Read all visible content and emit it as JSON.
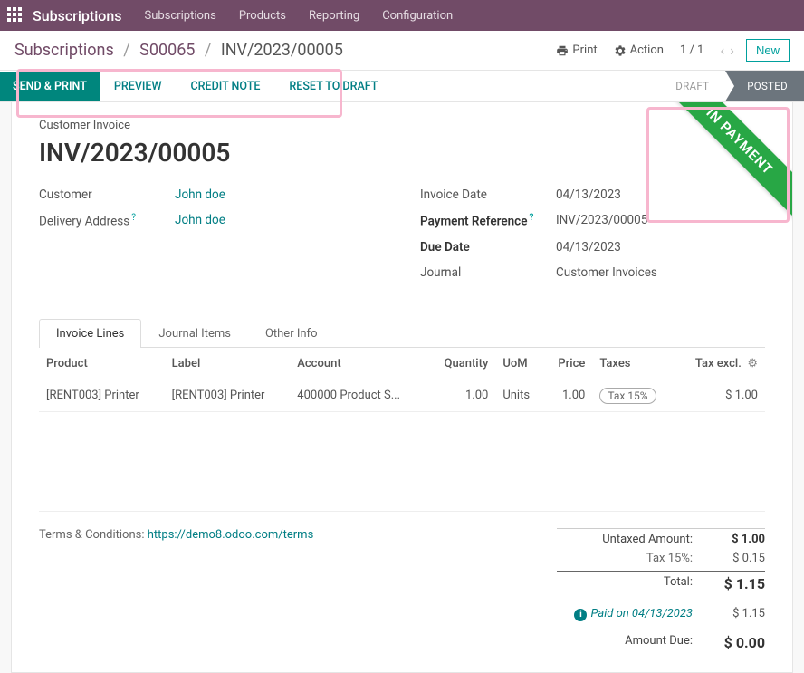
{
  "topnav": {
    "brand": "Subscriptions",
    "links": [
      "Subscriptions",
      "Products",
      "Reporting",
      "Configuration"
    ]
  },
  "crumb": {
    "root": "Subscriptions",
    "mid": "S00065",
    "current": "INV/2023/00005",
    "print": "Print",
    "action": "Action",
    "pager": "1 / 1",
    "new": "New"
  },
  "actions": {
    "send_print": "SEND & PRINT",
    "preview": "PREVIEW",
    "credit_note": "CREDIT NOTE",
    "reset_draft": "RESET TO DRAFT"
  },
  "status": {
    "draft": "DRAFT",
    "posted": "POSTED",
    "ribbon": "IN PAYMENT"
  },
  "doc": {
    "label": "Customer Invoice",
    "title": "INV/2023/00005"
  },
  "left": {
    "customer_l": "Customer",
    "customer_v": "John doe",
    "delivery_l": "Delivery Address",
    "delivery_v": "John doe"
  },
  "right": {
    "invdate_l": "Invoice Date",
    "invdate_v": "04/13/2023",
    "payref_l": "Payment Reference",
    "payref_v": "INV/2023/00005",
    "due_l": "Due Date",
    "due_v": "04/13/2023",
    "journal_l": "Journal",
    "journal_v": "Customer Invoices"
  },
  "tabs": {
    "lines": "Invoice Lines",
    "journal": "Journal Items",
    "other": "Other Info"
  },
  "th": {
    "product": "Product",
    "label": "Label",
    "account": "Account",
    "qty": "Quantity",
    "uom": "UoM",
    "price": "Price",
    "taxes": "Taxes",
    "taxexcl": "Tax excl."
  },
  "row": {
    "product": "[RENT003] Printer",
    "label": "[RENT003] Printer",
    "account": "400000 Product S...",
    "qty": "1.00",
    "uom": "Units",
    "price": "1.00",
    "taxes": "Tax 15%",
    "taxexcl": "$ 1.00"
  },
  "terms": {
    "label": "Terms & Conditions:",
    "link": "https://demo8.odoo.com/terms"
  },
  "totals": {
    "untaxed_l": "Untaxed Amount:",
    "untaxed_v": "$ 1.00",
    "tax_l": "Tax 15%:",
    "tax_v": "$ 0.15",
    "total_l": "Total:",
    "total_v": "$ 1.15",
    "paid_l": "Paid on 04/13/2023",
    "paid_v": "$ 1.15",
    "due_l": "Amount Due:",
    "due_v": "$ 0.00"
  }
}
